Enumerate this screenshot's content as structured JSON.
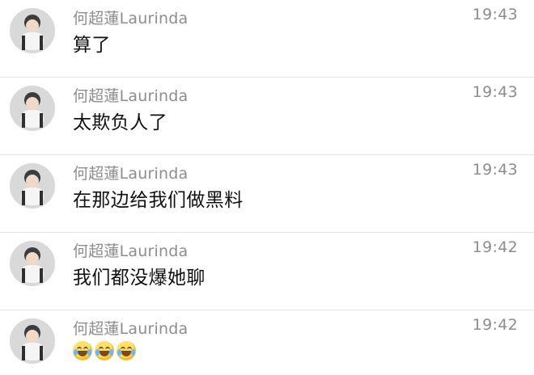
{
  "messages": [
    {
      "sender": "何超蓮Laurinda",
      "time": "19:43",
      "text": "算了"
    },
    {
      "sender": "何超蓮Laurinda",
      "time": "19:43",
      "text": "太欺负人了"
    },
    {
      "sender": "何超蓮Laurinda",
      "time": "19:43",
      "text": "在那边给我们做黑料"
    },
    {
      "sender": "何超蓮Laurinda",
      "time": "19:42",
      "text": "我们都没爆她聊"
    },
    {
      "sender": "何超蓮Laurinda",
      "time": "19:42",
      "emoji": [
        "crying-laughing-emoji",
        "crying-laughing-emoji",
        "crying-laughing-emoji"
      ]
    }
  ]
}
